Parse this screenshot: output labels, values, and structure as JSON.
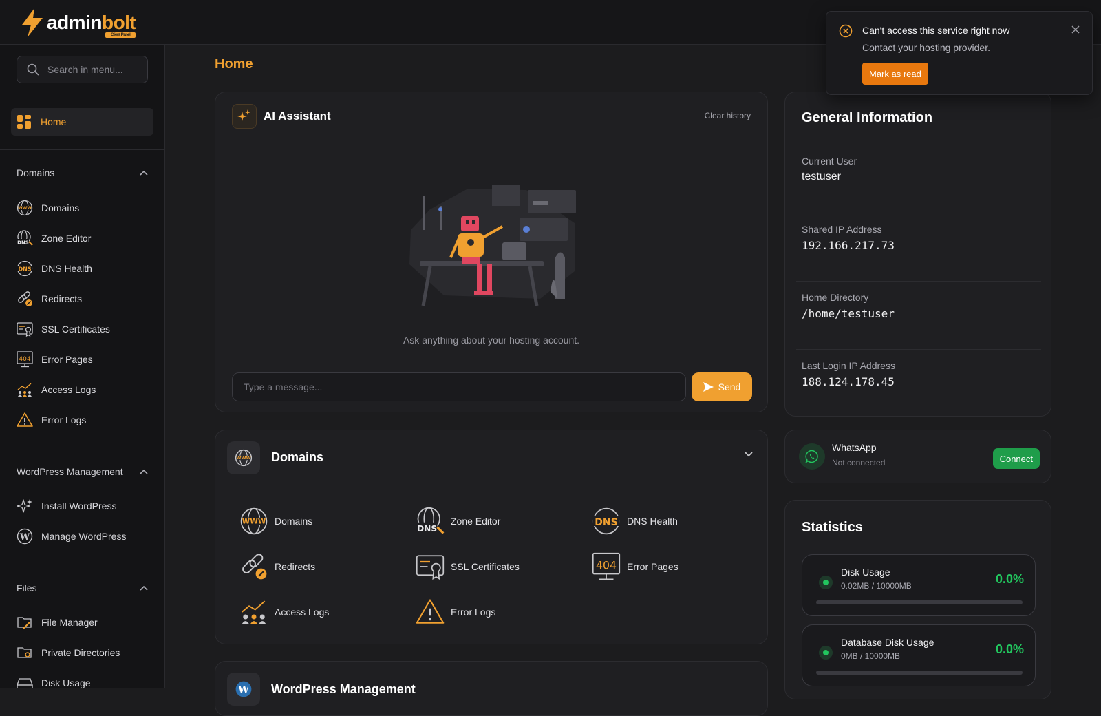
{
  "brand": {
    "name_part1": "admin",
    "name_part2": "bolt",
    "badge": "Client Panel",
    "accent_color": "#f0a030"
  },
  "sidebar": {
    "search_placeholder": "Search in menu...",
    "home_label": "Home",
    "sections": [
      {
        "title": "Domains",
        "items": [
          {
            "label": "Domains",
            "icon": "www-globe-icon"
          },
          {
            "label": "Zone Editor",
            "icon": "dns-globe-icon"
          },
          {
            "label": "DNS Health",
            "icon": "dns-health-icon"
          },
          {
            "label": "Redirects",
            "icon": "link-redirect-icon"
          },
          {
            "label": "SSL Certificates",
            "icon": "ssl-certificate-icon"
          },
          {
            "label": "Error Pages",
            "icon": "error-404-icon"
          },
          {
            "label": "Access Logs",
            "icon": "access-logs-icon"
          },
          {
            "label": "Error Logs",
            "icon": "warning-triangle-icon"
          }
        ]
      },
      {
        "title": "WordPress Management",
        "items": [
          {
            "label": "Install WordPress",
            "icon": "sparkles-icon"
          },
          {
            "label": "Manage WordPress",
            "icon": "wordpress-icon"
          }
        ]
      },
      {
        "title": "Files",
        "items": [
          {
            "label": "File Manager",
            "icon": "folder-edit-icon"
          },
          {
            "label": "Private Directories",
            "icon": "folder-lock-icon"
          },
          {
            "label": "Disk Usage",
            "icon": "disk-icon"
          }
        ]
      }
    ]
  },
  "main": {
    "page_title": "Home",
    "ai": {
      "title": "AI Assistant",
      "clear_label": "Clear history",
      "hint": "Ask anything about your hosting account.",
      "input_placeholder": "Type a message...",
      "send_label": "Send"
    },
    "domains_card": {
      "title": "Domains",
      "tools": [
        {
          "label": "Domains",
          "icon": "www-globe-icon"
        },
        {
          "label": "Zone Editor",
          "icon": "dns-globe-icon"
        },
        {
          "label": "DNS Health",
          "icon": "dns-health-icon"
        },
        {
          "label": "Redirects",
          "icon": "link-redirect-icon"
        },
        {
          "label": "SSL Certificates",
          "icon": "ssl-certificate-icon"
        },
        {
          "label": "Error Pages",
          "icon": "error-404-icon"
        },
        {
          "label": "Access Logs",
          "icon": "access-logs-icon"
        },
        {
          "label": "Error Logs",
          "icon": "warning-triangle-icon"
        }
      ]
    },
    "wp_card": {
      "title": "WordPress Management"
    }
  },
  "info": {
    "title": "General Information",
    "rows": [
      {
        "label": "Current User",
        "value": "testuser"
      },
      {
        "label": "Shared IP Address",
        "value": "192.166.217.73"
      },
      {
        "label": "Home Directory",
        "value": "/home/testuser"
      },
      {
        "label": "Last Login IP Address",
        "value": "188.124.178.45"
      }
    ]
  },
  "whatsapp": {
    "name": "WhatsApp",
    "status": "Not connected",
    "button": "Connect"
  },
  "stats": {
    "title": "Statistics",
    "items": [
      {
        "name": "Disk Usage",
        "sub": "0.02MB / 10000MB",
        "pct": "0.0%",
        "fraction": 0.0
      },
      {
        "name": "Database Disk Usage",
        "sub": "0MB / 10000MB",
        "pct": "0.0%",
        "fraction": 0.0
      }
    ]
  },
  "toast": {
    "title": "Can't access this service right now",
    "message": "Contact your hosting provider.",
    "button": "Mark as read"
  }
}
